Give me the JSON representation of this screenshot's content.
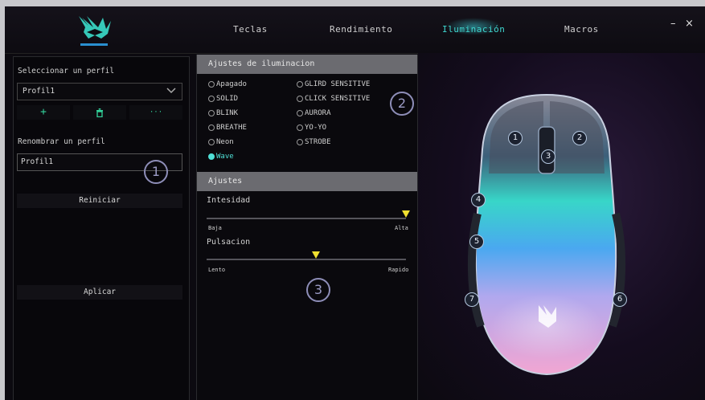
{
  "header": {
    "tabs": [
      {
        "label": "Teclas",
        "active": false
      },
      {
        "label": "Rendimiento",
        "active": false
      },
      {
        "label": "Iluminación",
        "active": true
      },
      {
        "label": "Macros",
        "active": false
      }
    ],
    "minimize": "–",
    "close": "×",
    "accent": "#3fd7d0",
    "logo_icon": "phoenix-logo-icon"
  },
  "profile_panel": {
    "select_label": "Seleccionar un perfil",
    "selected_profile": "Profil1",
    "actions": [
      {
        "icon": "plus-icon",
        "glyph": "+"
      },
      {
        "icon": "trash-icon",
        "glyph": "🗑"
      },
      {
        "icon": "more-icon",
        "glyph": "···"
      }
    ],
    "rename_label": "Renombrar un perfil",
    "rename_value": "Profil1",
    "reset_button": "Reiniciar",
    "apply_button": "Aplicar",
    "badge": "1"
  },
  "lighting": {
    "header": "Ajustes de iluminacion",
    "badge": "2",
    "modes_left": [
      "Apagado",
      "SOLID",
      "BLINK",
      "BREATHE",
      "Neon",
      "Wave"
    ],
    "modes_right": [
      "GLIRD SENSITIVE",
      "CLICK SENSITIVE",
      "AURORA",
      "YO-YO",
      "STROBE"
    ],
    "selected_mode": "Wave",
    "selected_color": "#4fe0d6"
  },
  "adjust": {
    "header": "Ajustes",
    "badge": "3",
    "intensity": {
      "label": "Intesidad",
      "min_label": "Baja",
      "max_label": "Alta",
      "value": 1.0
    },
    "pulse": {
      "label": "Pulsacion",
      "min_label": "Lento",
      "max_label": "Rapido",
      "value": 0.55
    },
    "thumb_color": "#f0e030"
  },
  "mouse": {
    "buttons": [
      "1",
      "2",
      "3",
      "4",
      "5",
      "6",
      "7"
    ]
  }
}
